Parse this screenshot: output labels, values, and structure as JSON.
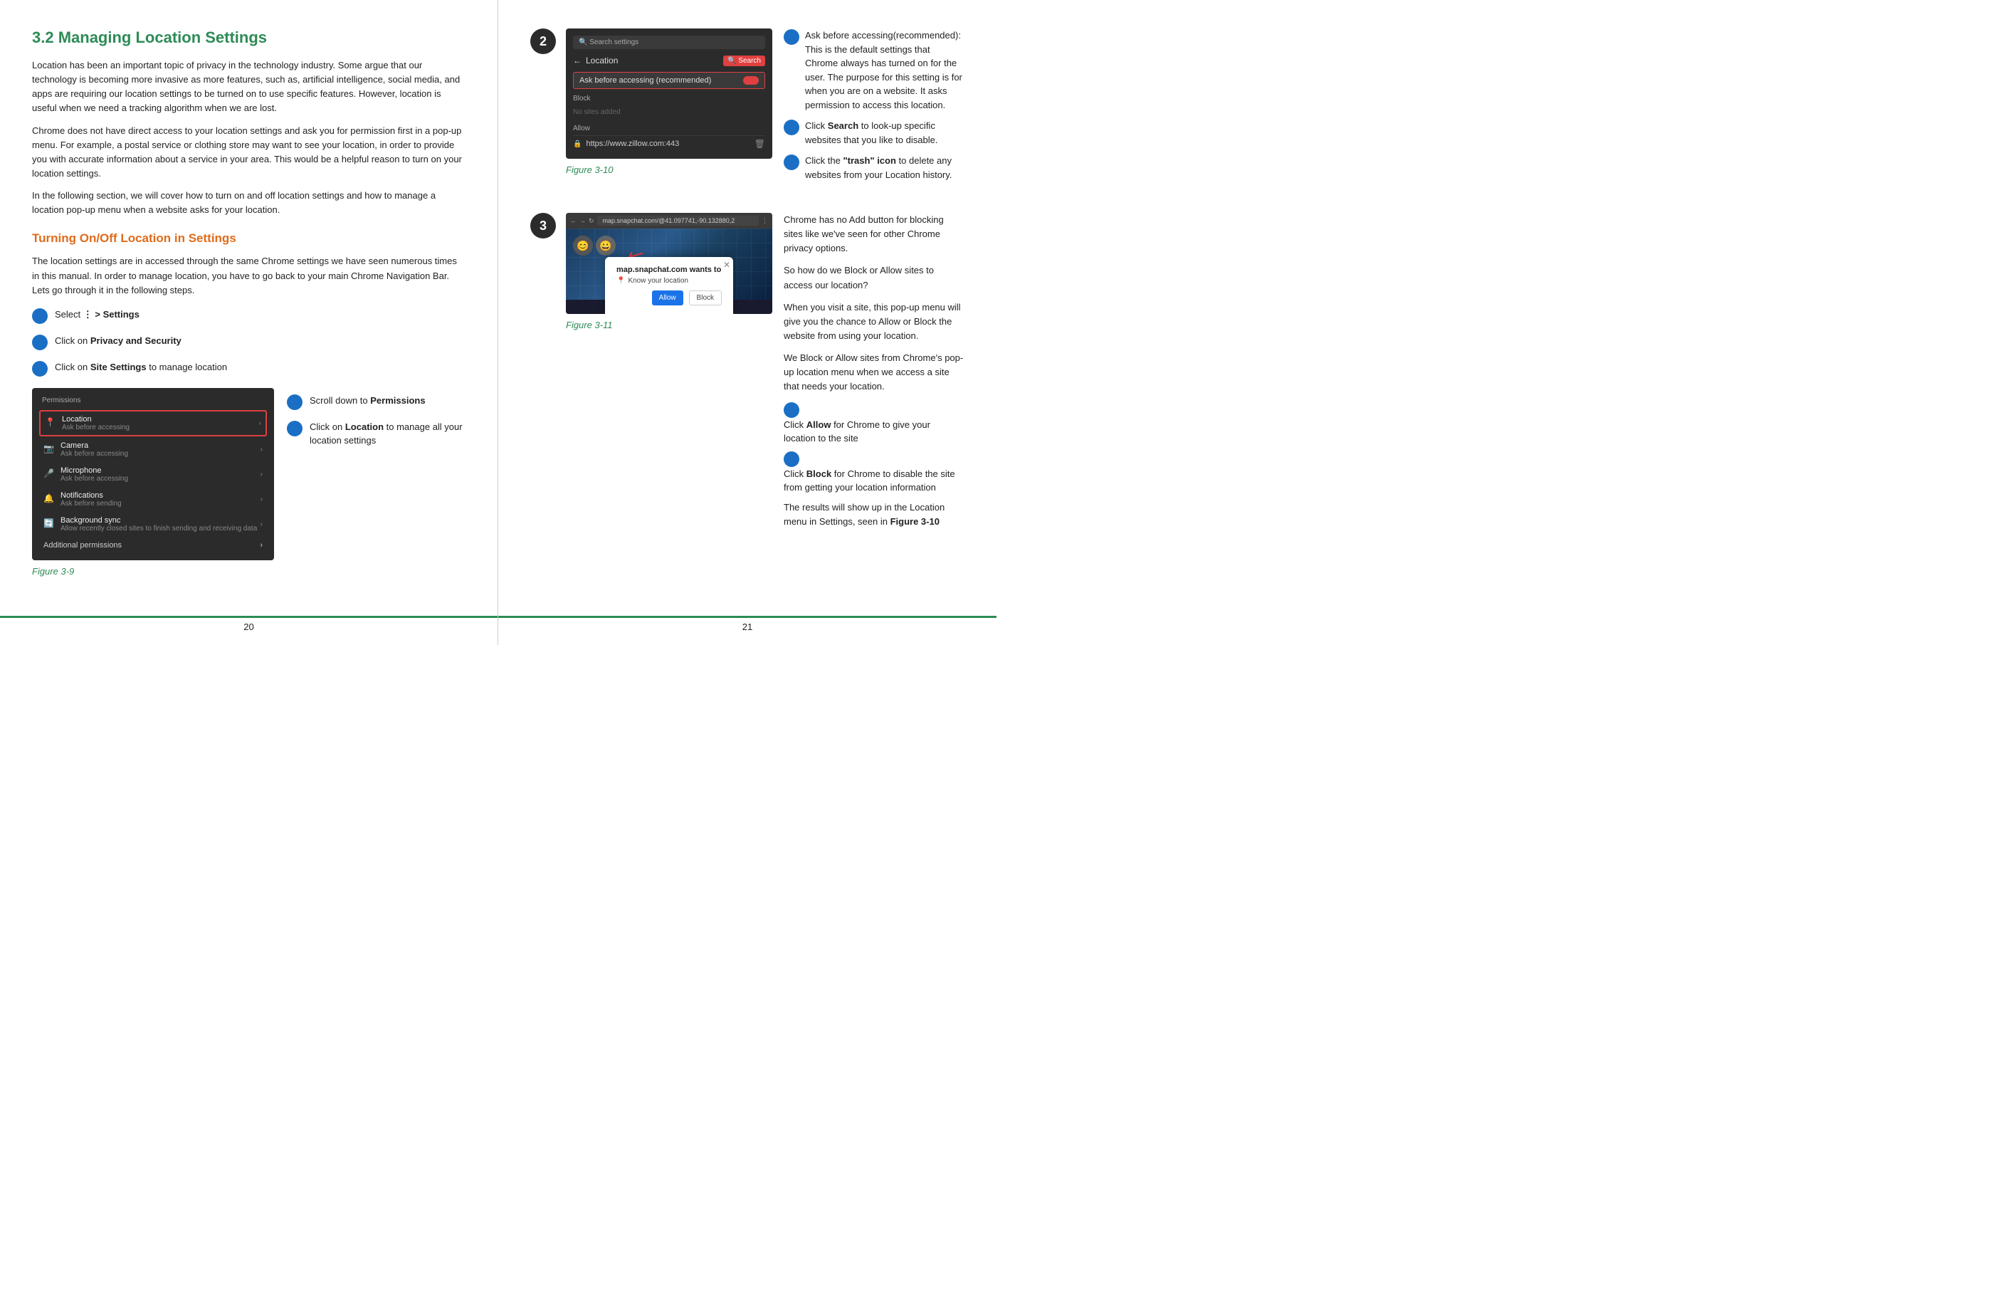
{
  "left": {
    "section_title": "3.2 Managing Location Settings",
    "para1": "Location has been an important topic of privacy in the technology industry. Some argue that our technology is becoming more invasive as more features, such as, artificial intelligence, social media, and apps are requiring our location settings to be turned on to use specific features. However, location is useful when we need a tracking algorithm when we are lost.",
    "para2": "Chrome does not have direct access to your location settings and ask you for permission first in a pop-up menu. For example, a postal service or clothing store may want to see your location, in order to provide you with accurate information about a service in your area. This would be a helpful reason to turn on your location settings.",
    "para3": "In the following section, we will cover how to turn on and off location settings and how to manage a location pop-up menu when a website asks for your location.",
    "subtitle": "Turning On/Off Location in Settings",
    "sub_para1": "The location settings are in accessed through the same Chrome settings we have seen numerous times in this manual. In order to manage location, you have to go back to your main Chrome Navigation Bar. Lets go through it in the following steps.",
    "steps": [
      {
        "label": "Select",
        "bold": "⋮ > Settings"
      },
      {
        "label": "Click on",
        "bold": "Privacy and Security"
      },
      {
        "label": "Click on",
        "bold": "Site Settings",
        "suffix": " to manage location"
      }
    ],
    "fig1_label": "Figure 3-9",
    "step_scroll": "Scroll down to",
    "step_scroll_bold": "Permissions",
    "step_click": "Click on",
    "step_click_bold": "Location",
    "step_click_suffix": " to manage all your location settings",
    "page_num": "20",
    "fig39": {
      "perm_header": "Permissions",
      "rows": [
        {
          "icon": "📍",
          "name": "Location",
          "sub": "Ask before accessing",
          "highlighted": true
        },
        {
          "icon": "📷",
          "name": "Camera",
          "sub": "Ask before accessing",
          "highlighted": false
        },
        {
          "icon": "🎤",
          "name": "Microphone",
          "sub": "Ask before accessing",
          "highlighted": false
        },
        {
          "icon": "🔔",
          "name": "Notifications",
          "sub": "Ask before sending",
          "highlighted": false
        },
        {
          "icon": "🔄",
          "name": "Background sync",
          "sub": "Allow recently closed sites to finish sending and receiving data",
          "highlighted": false
        }
      ],
      "add_perms": "Additional permissions"
    }
  },
  "right": {
    "page_num": "21",
    "fig2_badge": "2",
    "fig3_badge": "3",
    "fig2_label": "Figure 3-10",
    "fig3_label": "Figure 3-11",
    "fig10": {
      "search_placeholder": "Search settings",
      "location_title": "Location",
      "ask_before": "Ask before accessing (recommended)",
      "block_label": "Block",
      "no_sites": "No sites added",
      "allow_label": "Allow",
      "site": "https://www.zillow.com:443"
    },
    "fig11": {
      "site_name": "map.snapchat.com",
      "url": "map.snapchat.com/@41.09774 1,-90.132880,2",
      "popup_site": "map.snapchat.com wants to",
      "popup_action": "Know your location",
      "btn_allow": "Allow",
      "btn_block": "Block"
    },
    "info2": {
      "items": [
        {
          "text": "Ask before accessing(recommended): This is the default settings that Chrome always has turned on for the user. The purpose for this setting is for when you are on a website. It asks permission to access this location."
        },
        {
          "prefix": "Click ",
          "bold": "Search",
          "suffix": " to look-up specific websites that you like to disable."
        },
        {
          "prefix": "Click the ",
          "bold": "\"trash\" icon",
          "suffix": " to delete any websites from your Location history."
        }
      ]
    },
    "info3": {
      "para1": "Chrome has no Add button for blocking sites like we've seen for other Chrome privacy options.",
      "para2": "So how do we Block or Allow sites to access our location?",
      "para3": "When you visit a site, this pop-up menu will give you the chance to Allow or Block the website from using your location.",
      "para4": "We Block or Allow sites from Chrome's pop-up location menu when we access a site that needs your location.",
      "step_allow_prefix": "Click ",
      "step_allow_bold": "Allow",
      "step_allow_suffix": " for Chrome to give your location to the site",
      "step_block_prefix": "Click ",
      "step_block_bold": "Block",
      "step_block_suffix": " for Chrome to disable the site from getting your location information",
      "para5": "The results will show up in the Location menu in Settings, seen in",
      "para5_bold": "Figure 3-10"
    }
  }
}
